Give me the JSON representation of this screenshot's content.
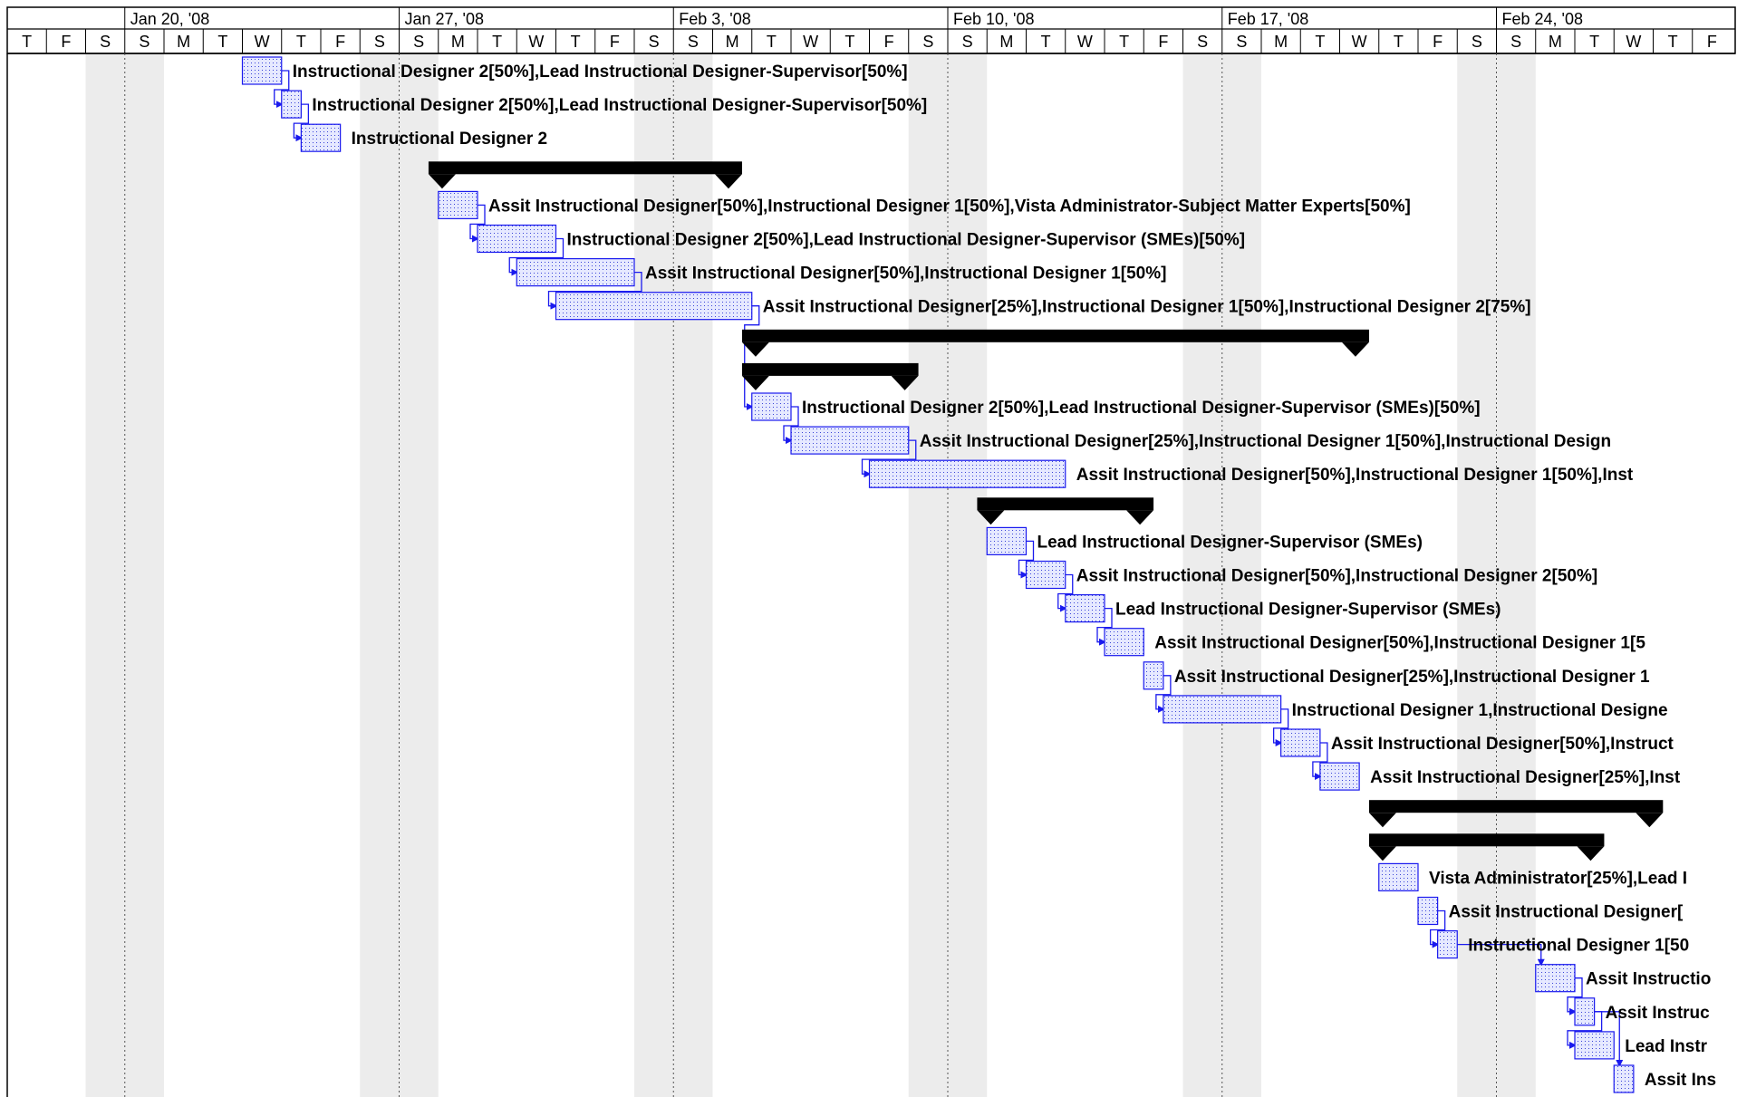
{
  "timescale": {
    "weeks": [
      "Jan 20, '08",
      "Jan 27, '08",
      "Feb 3, '08",
      "Feb 10, '08",
      "Feb 17, '08",
      "Feb 24, '08"
    ],
    "days": [
      "T",
      "F",
      "S",
      "S",
      "M",
      "T",
      "W",
      "T",
      "F",
      "S",
      "S",
      "M",
      "T",
      "W",
      "T",
      "F",
      "S",
      "S",
      "M",
      "T",
      "W",
      "T",
      "F",
      "S",
      "S",
      "M",
      "T",
      "W",
      "T",
      "F",
      "S",
      "S",
      "M",
      "T",
      "W",
      "T",
      "F",
      "S",
      "S",
      "M",
      "T",
      "W",
      "T",
      "F"
    ]
  },
  "colors": {
    "task_fill": "#dfe3ff",
    "task_border": "#1a1aee",
    "link": "#1a1aee",
    "summary": "#000000",
    "nonworking": "#ececec",
    "grid": "#000000"
  },
  "rows": [
    {
      "type": "task",
      "start": 6.0,
      "end": 7.0,
      "label": "Instructional Designer 2[50%],Lead Instructional Designer-Supervisor[50%]"
    },
    {
      "type": "task",
      "start": 7.0,
      "end": 7.5,
      "label": "Instructional Designer 2[50%],Lead Instructional Designer-Supervisor[50%]"
    },
    {
      "type": "task",
      "start": 7.5,
      "end": 8.5,
      "label": "Instructional Designer 2"
    },
    {
      "type": "summary",
      "start": 10.75,
      "end": 18.75,
      "label": ""
    },
    {
      "type": "task",
      "start": 11.0,
      "end": 12.0,
      "label": "Assit Instructional Designer[50%],Instructional Designer 1[50%],Vista Administrator-Subject Matter Experts[50%]"
    },
    {
      "type": "task",
      "start": 12.0,
      "end": 14.0,
      "label": "Instructional Designer 2[50%],Lead Instructional Designer-Supervisor (SMEs)[50%]"
    },
    {
      "type": "task",
      "start": 13.0,
      "end": 16.0,
      "label": "Assit Instructional Designer[50%],Instructional Designer 1[50%]"
    },
    {
      "type": "task",
      "start": 14.0,
      "end": 19.0,
      "label": "Assit Instructional Designer[25%],Instructional Designer 1[50%],Instructional Designer 2[75%]"
    },
    {
      "type": "summary",
      "start": 18.75,
      "end": 34.75,
      "label": ""
    },
    {
      "type": "summary",
      "start": 18.75,
      "end": 23.25,
      "label": ""
    },
    {
      "type": "task",
      "start": 19.0,
      "end": 20.0,
      "label": "Instructional Designer 2[50%],Lead Instructional Designer-Supervisor (SMEs)[50%]"
    },
    {
      "type": "task",
      "start": 20.0,
      "end": 23.0,
      "label": "Assit Instructional Designer[25%],Instructional Designer 1[50%],Instructional Design"
    },
    {
      "type": "task",
      "start": 22.0,
      "end": 27.0,
      "label": "Assit Instructional Designer[50%],Instructional Designer 1[50%],Inst"
    },
    {
      "type": "summary",
      "start": 24.75,
      "end": 29.25,
      "label": ""
    },
    {
      "type": "task",
      "start": 25.0,
      "end": 26.0,
      "label": "Lead Instructional Designer-Supervisor (SMEs)"
    },
    {
      "type": "task",
      "start": 26.0,
      "end": 27.0,
      "label": "Assit Instructional Designer[50%],Instructional Designer 2[50%]"
    },
    {
      "type": "task",
      "start": 27.0,
      "end": 28.0,
      "label": "Lead Instructional Designer-Supervisor (SMEs)"
    },
    {
      "type": "task",
      "start": 28.0,
      "end": 29.0,
      "label": "Assit Instructional Designer[50%],Instructional Designer 1[5"
    },
    {
      "type": "task",
      "start": 29.0,
      "end": 29.5,
      "label": "Assit Instructional Designer[25%],Instructional Designer 1"
    },
    {
      "type": "task",
      "start": 29.5,
      "end": 32.5,
      "label": "Instructional Designer 1,Instructional Designe"
    },
    {
      "type": "task",
      "start": 32.5,
      "end": 33.5,
      "label": "Assit Instructional Designer[50%],Instruct"
    },
    {
      "type": "task",
      "start": 33.5,
      "end": 34.5,
      "label": "Assit Instructional Designer[25%],Inst"
    },
    {
      "type": "summary",
      "start": 34.75,
      "end": 42.25,
      "label": ""
    },
    {
      "type": "summary",
      "start": 34.75,
      "end": 40.75,
      "label": ""
    },
    {
      "type": "task",
      "start": 35.0,
      "end": 36.0,
      "label": "Vista Administrator[25%],Lead I"
    },
    {
      "type": "task",
      "start": 36.0,
      "end": 36.5,
      "label": "Assit Instructional Designer["
    },
    {
      "type": "task",
      "start": 36.5,
      "end": 37.0,
      "label": "Instructional Designer 1[50"
    },
    {
      "type": "task",
      "start": 39.0,
      "end": 40.0,
      "label": "Assit Instructio"
    },
    {
      "type": "task",
      "start": 40.0,
      "end": 40.5,
      "label": "Assit Instruc"
    },
    {
      "type": "task",
      "start": 40.0,
      "end": 41.0,
      "label": "Lead Instr"
    },
    {
      "type": "task",
      "start": 41.0,
      "end": 41.5,
      "label": "Assit Ins"
    }
  ],
  "links": [
    [
      0,
      1
    ],
    [
      1,
      2
    ],
    [
      4,
      5
    ],
    [
      5,
      6
    ],
    [
      6,
      7
    ],
    [
      7,
      10
    ],
    [
      10,
      11
    ],
    [
      11,
      12
    ],
    [
      14,
      15
    ],
    [
      15,
      16
    ],
    [
      16,
      17
    ],
    [
      18,
      19
    ],
    [
      19,
      20
    ],
    [
      20,
      21
    ],
    [
      25,
      26
    ],
    [
      26,
      27
    ],
    [
      27,
      28
    ],
    [
      28,
      29
    ],
    [
      28,
      30
    ]
  ]
}
